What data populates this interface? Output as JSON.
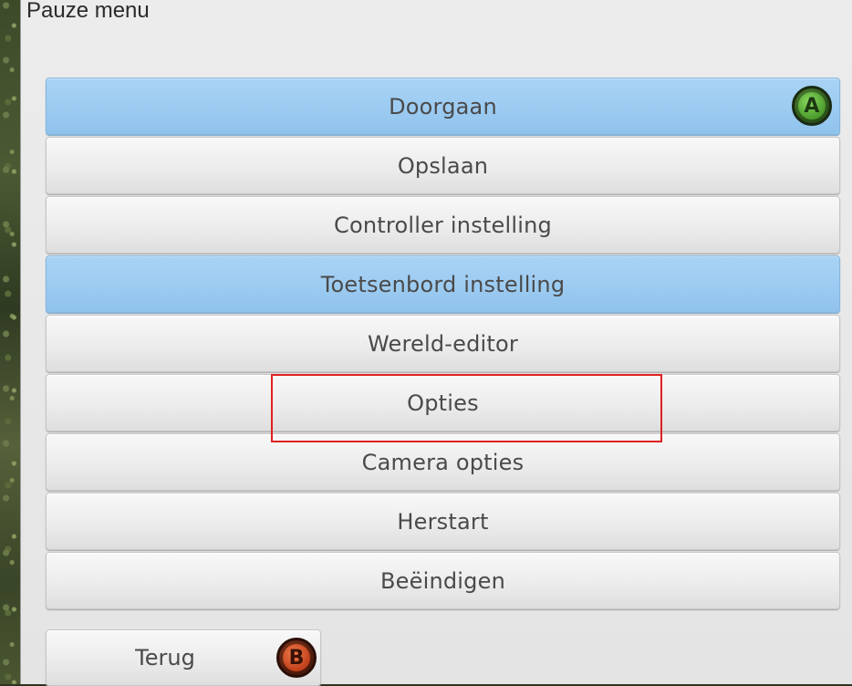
{
  "dialog": {
    "title": "Pauze menu"
  },
  "menu": {
    "items": [
      {
        "label": "Doorgaan",
        "highlighted": true,
        "badge": "A"
      },
      {
        "label": "Opslaan",
        "highlighted": false
      },
      {
        "label": "Controller instelling",
        "highlighted": false
      },
      {
        "label": "Toetsenbord instelling",
        "highlighted": true
      },
      {
        "label": "Wereld-editor",
        "highlighted": false
      },
      {
        "label": "Opties",
        "highlighted": false
      },
      {
        "label": "Camera opties",
        "highlighted": false
      },
      {
        "label": "Herstart",
        "highlighted": false
      },
      {
        "label": "Beëindigen",
        "highlighted": false
      }
    ]
  },
  "back": {
    "label": "Terug",
    "badge": "B"
  },
  "colors": {
    "highlight": "#9ccbf1",
    "button": "#ececec",
    "annotation": "#e02020",
    "badge_a": "#4c9c2c",
    "badge_b": "#c0401a"
  }
}
